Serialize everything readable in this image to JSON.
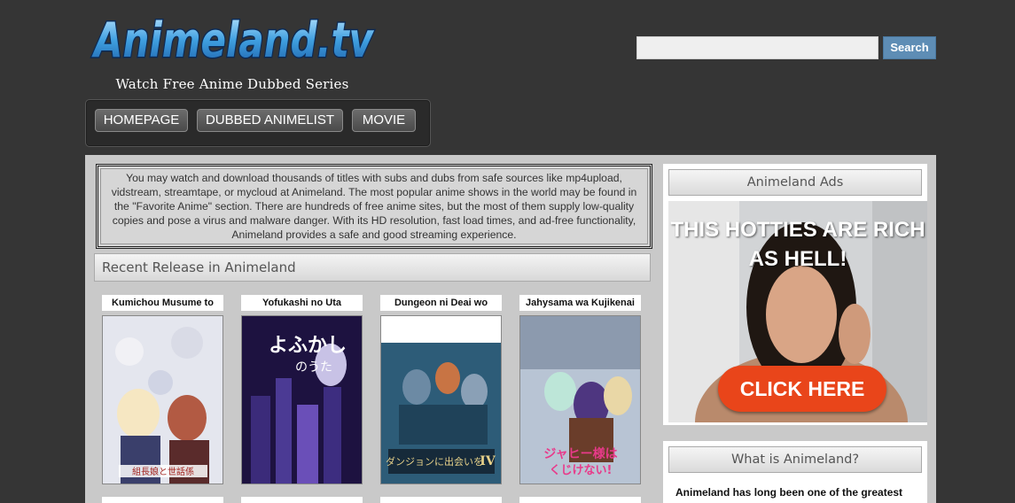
{
  "header": {
    "logo_text": "Animeland.tv",
    "tagline": "Watch Free Anime Dubbed Series"
  },
  "nav": {
    "home": "HOMEPAGE",
    "list": "DUBBED ANIMELIST",
    "movie": "MOVIE"
  },
  "search": {
    "value": "",
    "button": "Search"
  },
  "intro": {
    "text": "You may watch and download thousands of titles with subs and dubs from safe sources like mp4upload, vidstream, streamtape, or mycloud at Animeland. The most popular anime shows in the world may be found in the \"Favorite Anime\" section. There are hundreds of free anime sites, but the most of them supply low-quality copies and pose a virus and malware danger. With its HD resolution, fast load times, and ad-free functionality, Animeland provides a safe and good streaming experience."
  },
  "recent": {
    "title": "Recent Release in Animeland",
    "items": [
      {
        "title": "Kumichou Musume to",
        "poster_color": "#c9cfe0"
      },
      {
        "title": "Yofukashi no Uta",
        "poster_color": "#2c1a5e"
      },
      {
        "title": "Dungeon ni Deai wo",
        "poster_color": "#2d5c78"
      },
      {
        "title": "Jahysama wa Kujikenai",
        "poster_color": "#a9b7c9"
      }
    ]
  },
  "sidebar": {
    "ads_title": "Animeland Ads",
    "ad_headline": "THIS HOTTIES ARE RICH AS HELL!",
    "ad_cta": "CLICK HERE",
    "what_title": "What is Animeland?",
    "what_text": "Animeland has long been one of the greatest"
  },
  "colors": {
    "background": "#353535",
    "content_bg": "#c9c9c9",
    "search_button": "#5e8db5",
    "cta": "#e9451a"
  }
}
